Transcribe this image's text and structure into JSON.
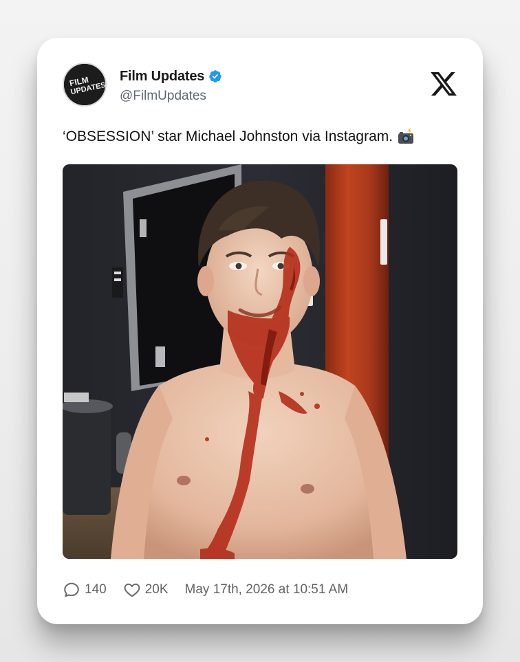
{
  "author": {
    "display_name": "Film Updates",
    "handle": "@FilmUpdates",
    "avatar_text": "FILM UPDATES",
    "verified": true
  },
  "tweet": {
    "text": "‘OBSESSION’ star Michael Johnston via Instagram.",
    "emoji": "camera-with-flash-icon",
    "image": "shirtless young man with stage blood on face and chest, backstage"
  },
  "stats": {
    "replies": "140",
    "likes": "20K",
    "timestamp": "May 17th, 2026 at 10:51 AM"
  },
  "colors": {
    "verified": "#1d9bf0",
    "text": "#141414",
    "muted": "#636363"
  }
}
